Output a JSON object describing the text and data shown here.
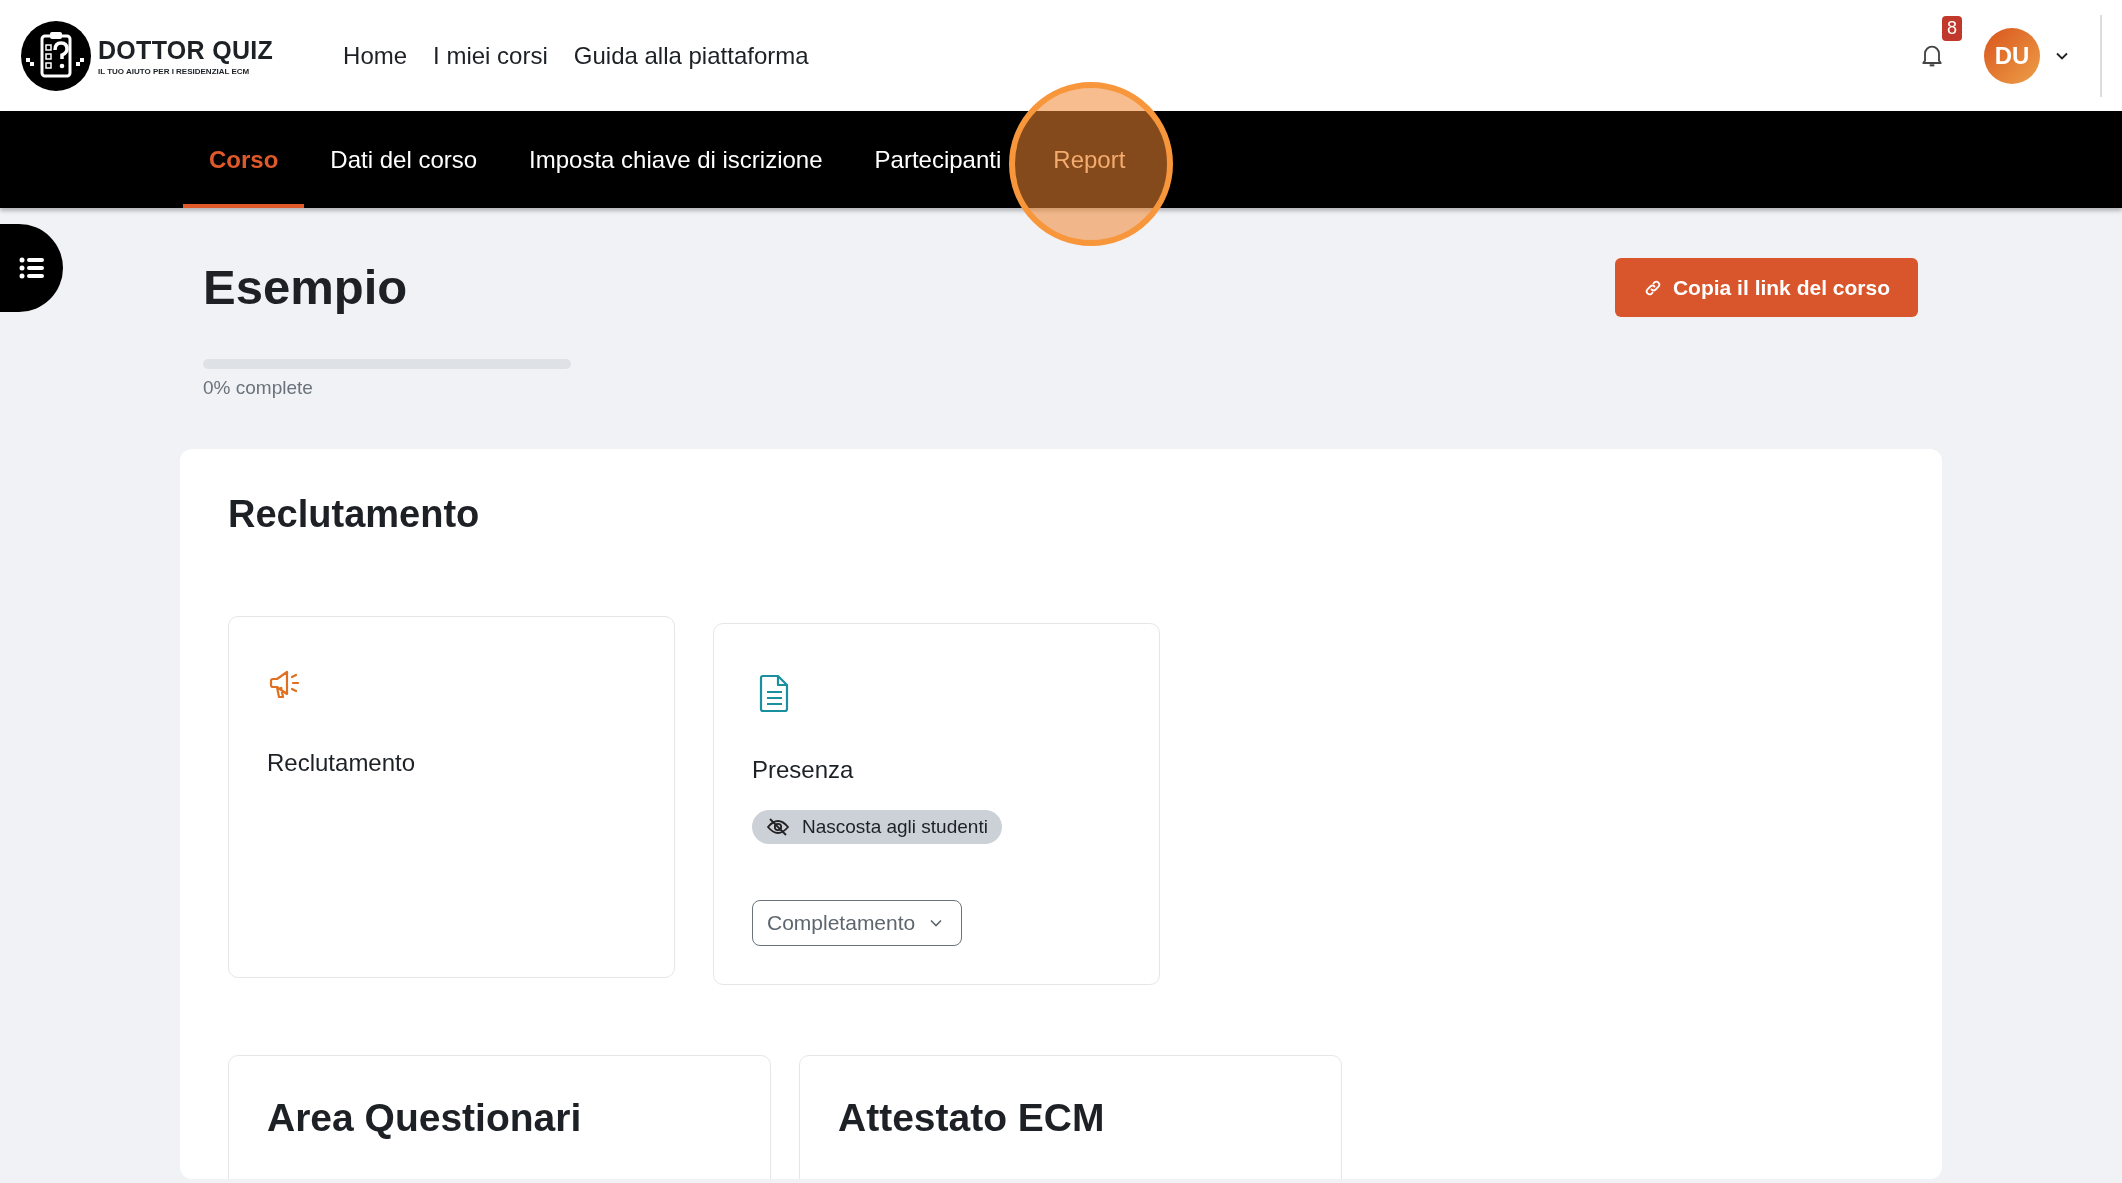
{
  "header": {
    "logo": {
      "title": "DOTTOR QUIZ",
      "tagline": "IL TUO AIUTO PER I RESIDENZIAL ECM"
    },
    "nav": [
      {
        "label": "Home"
      },
      {
        "label": "I miei corsi"
      },
      {
        "label": "Guida alla piattaforma"
      }
    ],
    "notifications": {
      "count": "8"
    },
    "user": {
      "initials": "DU"
    }
  },
  "course_nav": {
    "tabs": [
      {
        "label": "Corso",
        "selected": true,
        "highlighted": false
      },
      {
        "label": "Dati del corso",
        "selected": false,
        "highlighted": false
      },
      {
        "label": "Imposta chiave di iscrizione",
        "selected": false,
        "highlighted": false
      },
      {
        "label": "Partecipanti",
        "selected": false,
        "highlighted": false
      },
      {
        "label": "Report",
        "selected": false,
        "highlighted": true
      }
    ]
  },
  "course": {
    "title": "Esempio",
    "copy_link_button": "Copia il link del corso",
    "progress": {
      "level": 0,
      "label": "0% complete"
    },
    "section": {
      "title": "Reclutamento",
      "activities": [
        {
          "kind": "megaphone",
          "name": "Reclutamento"
        },
        {
          "kind": "document",
          "name": "Presenza",
          "badge": "Nascosta agli studenti",
          "dropdown": "Completamento"
        }
      ],
      "subsections": [
        {
          "title": "Area Questionari"
        },
        {
          "title": "Attestato ECM"
        }
      ]
    }
  }
}
